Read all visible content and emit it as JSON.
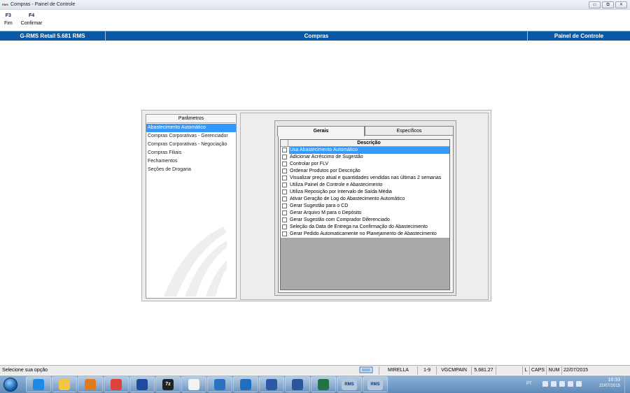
{
  "window": {
    "app_icon_text": "RMS",
    "title": "Compras - Painel de Controle",
    "controls": [
      "▭",
      "⧉",
      "✕"
    ]
  },
  "fkeys": [
    {
      "key": "F3",
      "label": "Fim"
    },
    {
      "key": "F4",
      "label": "Confirmar"
    }
  ],
  "header": {
    "left": "G-RMS Retail 5.681 RMS",
    "center": "Compras",
    "right": "Painel de Controle"
  },
  "parameters": {
    "header": "Parâmetros",
    "items": [
      "Abastecimento Automático",
      "Compras Corporativas - Gerenciador",
      "Compras Corporativas - Negociação",
      "Compras Filiais",
      "Fechamentos",
      "Seções de Drogaria"
    ],
    "selected_index": 0
  },
  "tabs": {
    "gerais": "Gerais",
    "especificos": "Específicos",
    "active": "gerais"
  },
  "grid": {
    "column": "Descrição",
    "rows": [
      {
        "text": "Usa Abastecimento Automático",
        "checked": false
      },
      {
        "text": "Adicionar Acréscimo de Sugestão",
        "checked": false
      },
      {
        "text": "Controlar por FLV",
        "checked": false
      },
      {
        "text": "Ordenar Produtos por Descrição",
        "checked": false
      },
      {
        "text": "Visualizar preço atual e quantidades vendidas nas últimas 2 semanas",
        "checked": false
      },
      {
        "text": "Utiliza Painel de Controle e Abastecimento",
        "checked": false
      },
      {
        "text": "Utiliza Reposição por Intervalo de Saída Média",
        "checked": false
      },
      {
        "text": "Ativar Geração de Log do Abastecimento Automático",
        "checked": false
      },
      {
        "text": "Gerar Sugestão para o CD",
        "checked": false
      },
      {
        "text": "Gerar Arquivo M para o Depósito",
        "checked": false
      },
      {
        "text": "Gerar Sugestão com Comprador Diferenciado",
        "checked": false
      },
      {
        "text": "Seleção da Data de Entrega na Confirmação do Abastecimento",
        "checked": false
      },
      {
        "text": "Gerar Pedido Automaticamente no Planejamento de Abastecimento",
        "checked": false
      }
    ],
    "selected_index": 0
  },
  "status": {
    "message": "Selecione sua opção",
    "user": "MIRELLA",
    "range": "1-9",
    "program": "VGCMPAIN",
    "version": "5.681.27",
    "l": "L",
    "caps": "CAPS",
    "num": "NUM",
    "date": "22/07/2015"
  },
  "taskbar": {
    "apps": [
      "ie-icon",
      "explorer-icon",
      "media-player-icon",
      "chrome-icon",
      "app-icon",
      "7zip-icon",
      "document-icon",
      "lync-icon",
      "outlook-icon",
      "remote-icon",
      "word-icon",
      "excel-icon",
      "rms-icon",
      "rms-icon"
    ],
    "app_labels": {
      "7zip": "7z",
      "rms1": "RMS",
      "rms2": "RMS"
    },
    "lang": "PT",
    "time": "16:33",
    "date": "22/07/2015"
  }
}
